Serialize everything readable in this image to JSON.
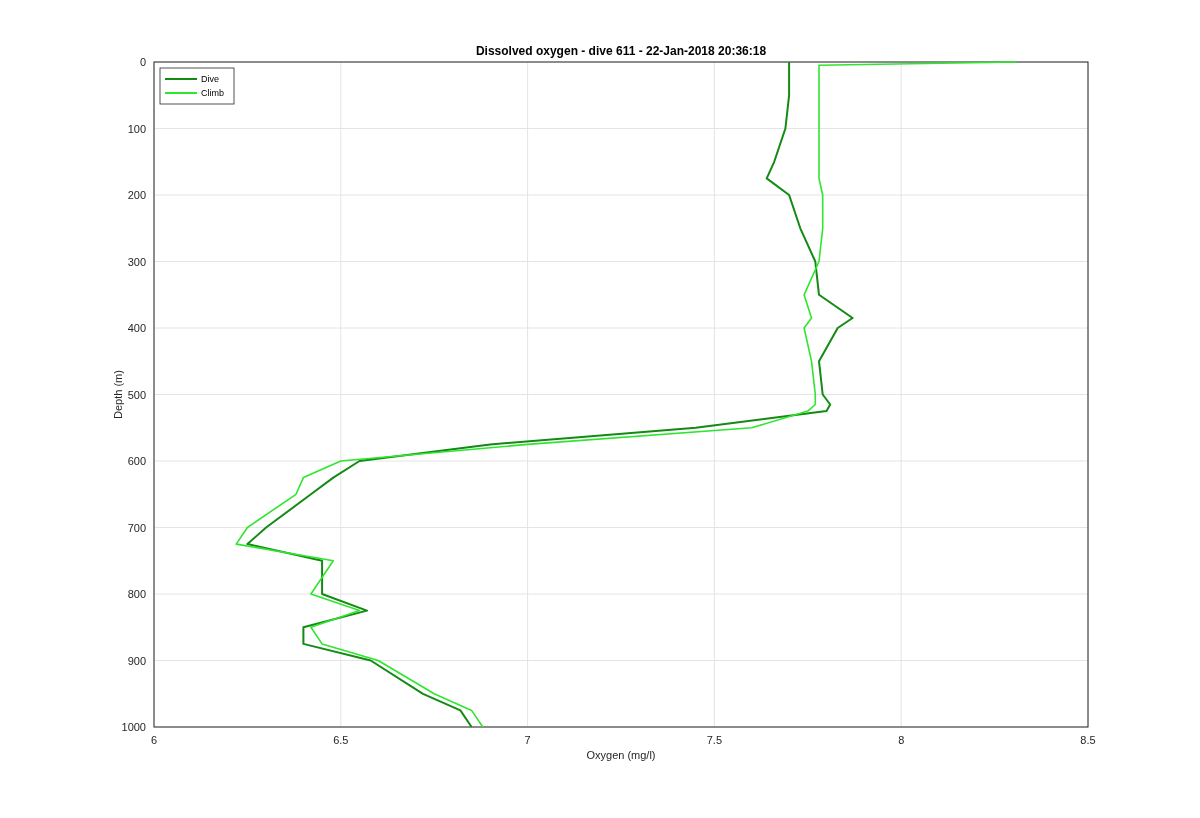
{
  "figure": {
    "chart_data": {
      "type": "line",
      "orientation": "horizontal",
      "title": "Dissolved oxygen - dive 611 - 22-Jan-2018 20:36:18",
      "xlabel": "Oxygen (mg/l)",
      "ylabel": "Depth (m)",
      "x": [
        0,
        5,
        50,
        100,
        150,
        175,
        200,
        250,
        300,
        350,
        385,
        400,
        450,
        500,
        515,
        525,
        550,
        575,
        600,
        625,
        650,
        700,
        725,
        750,
        800,
        825,
        850,
        875,
        900,
        950,
        975,
        1000
      ],
      "series": [
        {
          "name": "Dive",
          "color": "#138a13",
          "values": [
            7.7,
            7.7,
            7.7,
            7.69,
            7.66,
            7.64,
            7.7,
            7.73,
            7.77,
            7.78,
            7.87,
            7.83,
            7.78,
            7.79,
            7.81,
            7.8,
            7.45,
            6.9,
            6.55,
            6.48,
            6.42,
            6.3,
            6.25,
            6.45,
            6.45,
            6.57,
            6.4,
            6.4,
            6.58,
            6.72,
            6.82,
            6.85
          ]
        },
        {
          "name": "Climb",
          "color": "#2ee62e",
          "values": [
            8.31,
            7.78,
            7.78,
            7.78,
            7.78,
            7.78,
            7.79,
            7.79,
            7.78,
            7.74,
            7.76,
            7.74,
            7.76,
            7.77,
            7.77,
            7.75,
            7.6,
            7.0,
            6.5,
            6.4,
            6.38,
            6.25,
            6.22,
            6.48,
            6.42,
            6.55,
            6.42,
            6.45,
            6.6,
            6.75,
            6.85,
            6.88
          ]
        }
      ],
      "grid": true,
      "legend": true,
      "xlim": [
        6,
        8.5
      ],
      "ylim": [
        1000,
        0
      ],
      "xticks": [
        6,
        6.5,
        7,
        7.5,
        8,
        8.5
      ],
      "yticks": [
        0,
        100,
        200,
        300,
        400,
        500,
        600,
        700,
        800,
        900,
        1000
      ]
    }
  }
}
